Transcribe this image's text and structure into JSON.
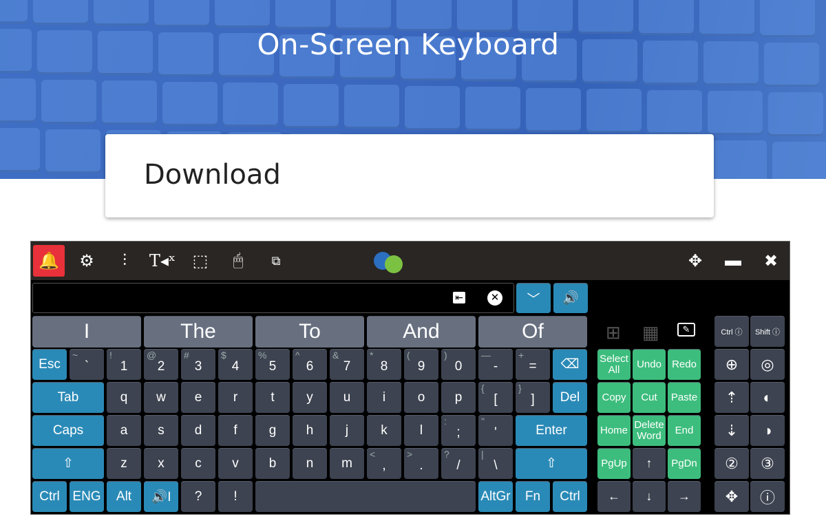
{
  "hero": {
    "title": "On-Screen Keyboard"
  },
  "download": {
    "label": "Download"
  },
  "colors": {
    "blue_key": "#2a8ab7",
    "dark_key": "#3d4350",
    "green_key": "#3dbd7d",
    "suggestion": "#687080",
    "alert": "#e8313a",
    "toolbar": "#2a2623"
  },
  "toolbar": {
    "icons": [
      "bell-icon",
      "gear-icon",
      "sliders-icon",
      "text-to-speech-mute-icon",
      "screen-select-icon",
      "mouse-icon",
      "window-switch-icon"
    ],
    "right_icons": [
      "move-icon",
      "minimize-icon",
      "close-icon"
    ]
  },
  "input": {
    "value": "",
    "buttons": [
      "insert-word-icon",
      "clear-icon"
    ],
    "dropdown_icon": "chevron-down-icon",
    "speak_icon": "speaker-icon"
  },
  "suggestions": [
    "I",
    "The",
    "To",
    "And",
    "Of"
  ],
  "rows": [
    [
      {
        "l": "Esc",
        "t": "b"
      },
      {
        "l": "`",
        "s": "~"
      },
      {
        "l": "1",
        "s": "!"
      },
      {
        "l": "2",
        "s": "@"
      },
      {
        "l": "3",
        "s": "#"
      },
      {
        "l": "4",
        "s": "$"
      },
      {
        "l": "5",
        "s": "%"
      },
      {
        "l": "6",
        "s": "^"
      },
      {
        "l": "7",
        "s": "&"
      },
      {
        "l": "8",
        "s": "*"
      },
      {
        "l": "9",
        "s": "("
      },
      {
        "l": "0",
        "s": ")"
      },
      {
        "l": "-",
        "s": "—"
      },
      {
        "l": "=",
        "s": "+"
      },
      {
        "l": "⌫",
        "t": "b"
      }
    ],
    [
      {
        "l": "Tab",
        "t": "b",
        "w": 2
      },
      {
        "l": "q"
      },
      {
        "l": "w"
      },
      {
        "l": "e"
      },
      {
        "l": "r"
      },
      {
        "l": "t"
      },
      {
        "l": "y"
      },
      {
        "l": "u"
      },
      {
        "l": "i"
      },
      {
        "l": "o"
      },
      {
        "l": "p"
      },
      {
        "l": "[",
        "s": "{"
      },
      {
        "l": "]",
        "s": "}"
      },
      {
        "l": "Del",
        "t": "b"
      }
    ],
    [
      {
        "l": "Caps",
        "t": "b",
        "w": 2
      },
      {
        "l": "a"
      },
      {
        "l": "s"
      },
      {
        "l": "d"
      },
      {
        "l": "f"
      },
      {
        "l": "g"
      },
      {
        "l": "h"
      },
      {
        "l": "j"
      },
      {
        "l": "k"
      },
      {
        "l": "l"
      },
      {
        "l": ";",
        "s": ":"
      },
      {
        "l": "'",
        "s": "\""
      },
      {
        "l": "Enter",
        "t": "b",
        "w": 2
      }
    ],
    [
      {
        "l": "⇧",
        "t": "b",
        "w": 2
      },
      {
        "l": "z"
      },
      {
        "l": "x"
      },
      {
        "l": "c"
      },
      {
        "l": "v"
      },
      {
        "l": "b"
      },
      {
        "l": "n"
      },
      {
        "l": "m"
      },
      {
        "l": ",",
        "s": "<"
      },
      {
        "l": ".",
        "s": ">"
      },
      {
        "l": "/",
        "s": "?"
      },
      {
        "l": "\\",
        "s": "|"
      },
      {
        "l": "⇧",
        "t": "b",
        "w": 2
      }
    ],
    [
      {
        "l": "Ctrl",
        "t": "b"
      },
      {
        "l": "ENG",
        "t": "b"
      },
      {
        "l": "Alt",
        "t": "b"
      },
      {
        "l": "🔊I",
        "t": "b"
      },
      {
        "l": "?"
      },
      {
        "l": "!"
      },
      {
        "l": "",
        "w": 6
      },
      {
        "l": "AltGr",
        "t": "b"
      },
      {
        "l": "Fn",
        "t": "b"
      },
      {
        "l": "Ctrl",
        "t": "b"
      }
    ]
  ],
  "edit_icons": [
    "windows-icon",
    "calculator-icon",
    "edit-icon"
  ],
  "edit_keys": [
    [
      {
        "l": "Select All",
        "t": "g"
      },
      {
        "l": "Undo",
        "t": "g"
      },
      {
        "l": "Redo",
        "t": "g"
      }
    ],
    [
      {
        "l": "Copy",
        "t": "g"
      },
      {
        "l": "Cut",
        "t": "g"
      },
      {
        "l": "Paste",
        "t": "g"
      }
    ],
    [
      {
        "l": "Home",
        "t": "g"
      },
      {
        "l": "Delete Word",
        "t": "g"
      },
      {
        "l": "End",
        "t": "g"
      }
    ],
    [
      {
        "l": "PgUp",
        "t": "g"
      },
      {
        "l": "↑"
      },
      {
        "l": "PgDn",
        "t": "g"
      }
    ],
    [
      {
        "l": "←"
      },
      {
        "l": "↓"
      },
      {
        "l": "→"
      }
    ]
  ],
  "mouse_keys": [
    [
      {
        "l": "Ctrl ⓘ",
        "n": "ctrl-click"
      },
      {
        "l": "Shift ⓘ",
        "n": "shift-click"
      }
    ],
    [
      {
        "l": "⊕",
        "n": "zoom"
      },
      {
        "l": "◎",
        "n": "target"
      }
    ],
    [
      {
        "l": "⇡",
        "n": "scroll-up"
      },
      {
        "l": "◐",
        "n": "left-click"
      }
    ],
    [
      {
        "l": "⇣",
        "n": "scroll-down"
      },
      {
        "l": "◑",
        "n": "right-click"
      }
    ],
    [
      {
        "l": "②",
        "n": "double-click"
      },
      {
        "l": "③",
        "n": "triple-click"
      }
    ],
    [
      {
        "l": "✥",
        "n": "drag"
      },
      {
        "l": "ⓘ",
        "n": "middle-click"
      }
    ]
  ]
}
